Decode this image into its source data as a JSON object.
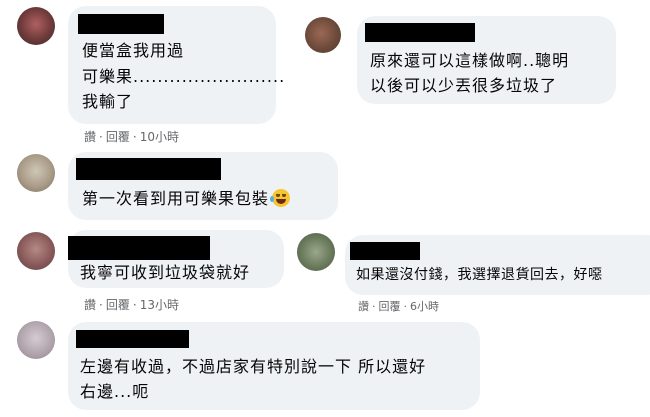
{
  "comments": [
    {
      "lines": [
        "便當盒我用過",
        "可樂果.........................",
        "我輸了"
      ],
      "actions": {
        "read": "讚",
        "reply": "回覆",
        "time": "10小時"
      }
    },
    {
      "lines": [
        "原來還可以這樣做啊..聰明",
        "以後可以少丟很多垃圾了"
      ]
    },
    {
      "lines": [
        "第一次看到用可樂果包裝"
      ],
      "emoji": "face-with-tears-of-joy-icon"
    },
    {
      "lines": [
        "我寧可收到垃圾袋就好"
      ],
      "actions": {
        "read": "讚",
        "reply": "回覆",
        "time": "13小時"
      }
    },
    {
      "lines": [
        "如果還沒付錢，我選擇退貨回去，好噁"
      ],
      "actions": {
        "read": "讚",
        "reply": "回覆",
        "time": "6小時"
      }
    },
    {
      "lines": [
        "左邊有收過，不過店家有特別說一下 所以還好",
        "右邊...呃"
      ]
    }
  ],
  "separator": "·",
  "colors": {
    "bubble": "#eff2f5",
    "meta": "#65676b",
    "text": "#050505"
  }
}
